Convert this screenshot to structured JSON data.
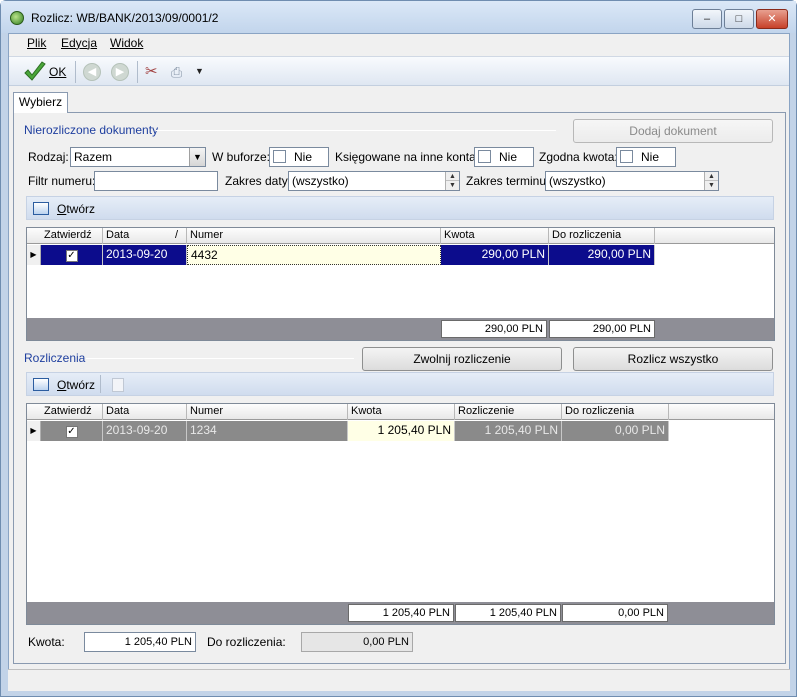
{
  "window": {
    "title": "Rozlicz: WB/BANK/2013/09/0001/2",
    "minimize_glyph": "‒",
    "maximize_glyph": "□",
    "close_glyph": "✕"
  },
  "menu": [
    "Plik",
    "Edycja",
    "Widok"
  ],
  "toolbar": {
    "ok_label": "OK",
    "icons": [
      "ok-check-icon",
      "back-icon",
      "forward-icon",
      "tools-icon",
      "print-icon",
      "dropdown-arrow-icon"
    ]
  },
  "tab": {
    "label": "Wybierz"
  },
  "unsettled": {
    "title": "Nierozliczone dokumenty",
    "add_button": "Dodaj dokument",
    "filters": {
      "rodzaj_label": "Rodzaj:",
      "rodzaj_value": "Razem",
      "w_buforze_label": "W buforze:",
      "w_buforze_value": "Nie",
      "ksiegowane_label": "Księgowane na inne konta:",
      "ksiegowane_value": "Nie",
      "zgodna_label": "Zgodna kwota:",
      "zgodna_value": "Nie",
      "filtr_label": "Filtr numeru:",
      "filtr_value": "",
      "zakres_daty_label": "Zakres daty:",
      "zakres_daty_value": "(wszystko)",
      "zakres_terminu_label": "Zakres terminu:",
      "zakres_terminu_value": "(wszystko)"
    },
    "open_label_prefix": "",
    "open_label_u": "O",
    "open_label_rest": "twórz",
    "columns": [
      "Zatwierdź",
      "Data",
      "Numer",
      "Kwota",
      "Do rozliczenia"
    ],
    "sort_indicator": "/",
    "rows": [
      {
        "checked": "✓",
        "date": "2013-09-20",
        "number": "4432",
        "amount": "290,00 PLN",
        "to_settle": "290,00 PLN"
      }
    ],
    "footer": {
      "amount": "290,00 PLN",
      "to_settle": "290,00 PLN"
    }
  },
  "settlements": {
    "title": "Rozliczenia",
    "release_button": "Zwolnij rozliczenie",
    "settle_all_button": "Rozlicz wszystko",
    "open_label_u": "O",
    "open_label_rest": "twórz",
    "columns": [
      "Zatwierdź",
      "Data",
      "Numer",
      "Kwota",
      "Rozliczenie",
      "Do rozliczenia"
    ],
    "rows": [
      {
        "checked": "✓",
        "date": "2013-09-20",
        "number": "1234",
        "amount": "1 205,40 PLN",
        "settlement": "1 205,40 PLN",
        "to_settle": "0,00 PLN"
      }
    ],
    "footer": {
      "amount": "1 205,40 PLN",
      "settlement": "1 205,40 PLN",
      "to_settle": "0,00 PLN"
    }
  },
  "summary": {
    "kwota_label": "Kwota:",
    "kwota_value": "1 205,40 PLN",
    "do_rozliczenia_label": "Do rozliczenia:",
    "do_rozliczenia_value": "0,00 PLN"
  }
}
